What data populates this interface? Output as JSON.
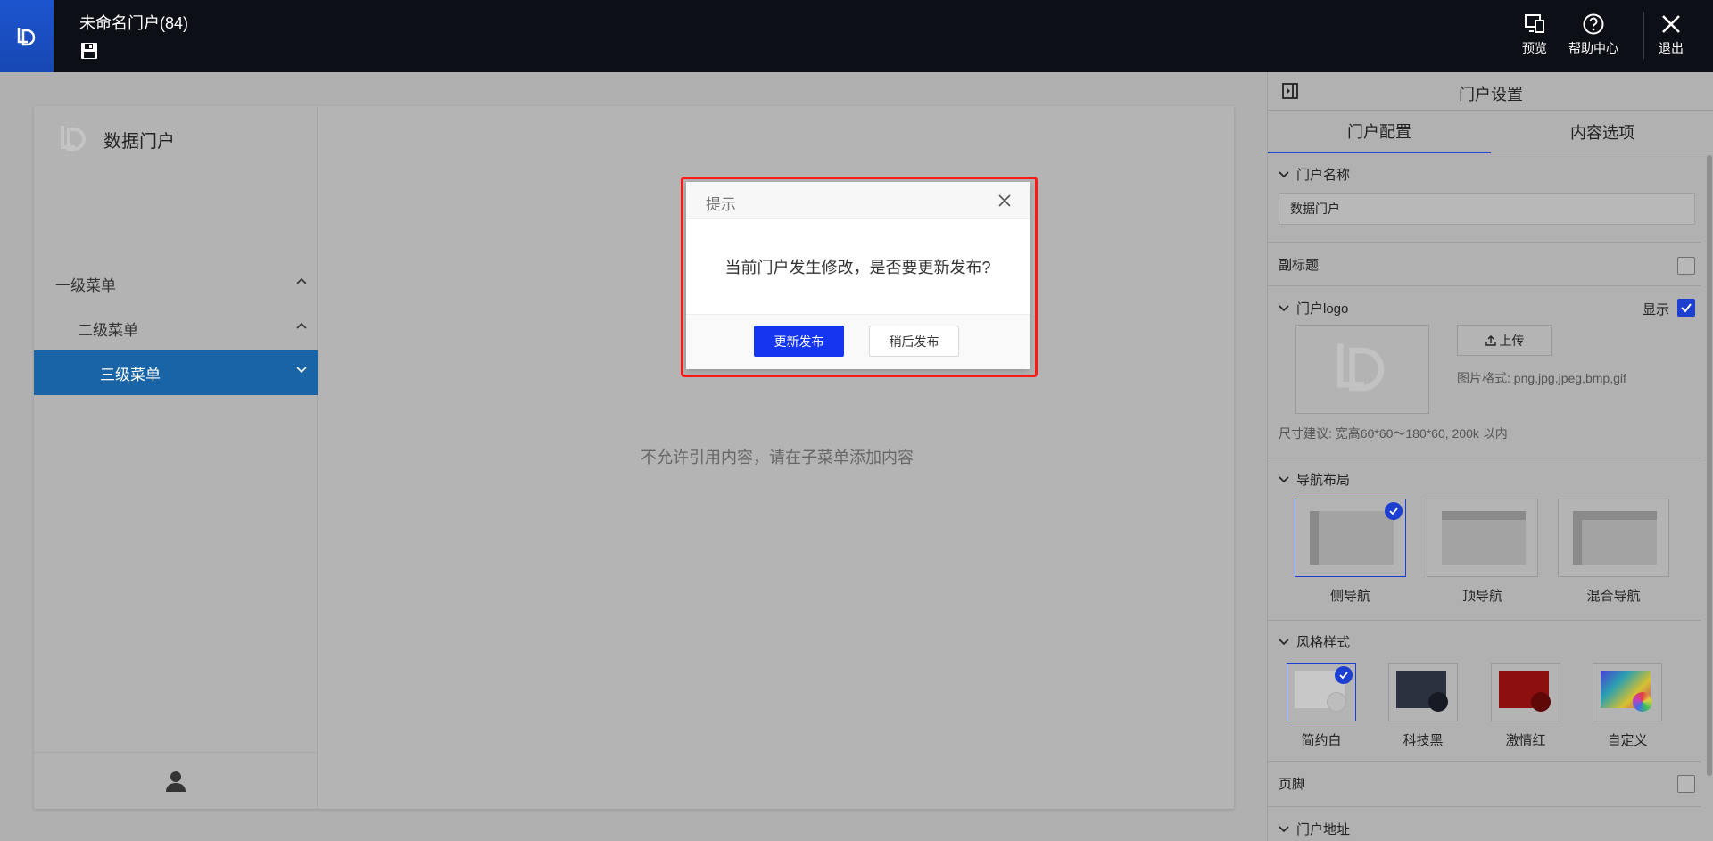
{
  "topbar": {
    "app_title": "未命名门户(84)",
    "actions": {
      "preview": "预览",
      "help": "帮助中心",
      "exit": "退出"
    }
  },
  "sidebar": {
    "brand": "数据门户",
    "menu": [
      {
        "label": "一级菜单",
        "level": 1,
        "expanded": true
      },
      {
        "label": "二级菜单",
        "level": 2,
        "expanded": true
      },
      {
        "label": "三级菜单",
        "level": 3,
        "selected": true
      }
    ]
  },
  "content": {
    "empty_text": "不允许引用内容，请在子菜单添加内容"
  },
  "panel": {
    "title": "门户设置",
    "tabs": [
      "门户配置",
      "内容选项"
    ],
    "active_tab": "门户配置",
    "portal_name": {
      "label": "门户名称",
      "value": "数据门户"
    },
    "subtitle": {
      "label": "副标题",
      "checked": false
    },
    "logo": {
      "label": "门户logo",
      "show_label": "显示",
      "show_checked": true,
      "upload_label": "上传",
      "format_hint": "图片格式: png,jpg,jpeg,bmp,gif",
      "size_hint": "尺寸建议: 宽高60*60～180*60, 200k 以内"
    },
    "nav_layout": {
      "label": "导航布局",
      "options": [
        "侧导航",
        "顶导航",
        "混合导航"
      ],
      "selected": "侧导航"
    },
    "style": {
      "label": "风格样式",
      "options": [
        {
          "name": "简约白",
          "color": "#d2d2d2"
        },
        {
          "name": "科技黑",
          "color": "#2a2e3e"
        },
        {
          "name": "激情红",
          "color": "#a01010"
        },
        {
          "name": "自定义",
          "color": "#6a5cd8"
        }
      ],
      "selected": "简约白"
    },
    "footer": {
      "label": "页脚",
      "checked": false
    },
    "address": {
      "label": "门户地址"
    }
  },
  "modal": {
    "title": "提示",
    "message": "当前门户发生修改，是否要更新发布?",
    "confirm": "更新发布",
    "cancel": "稍后发布"
  }
}
